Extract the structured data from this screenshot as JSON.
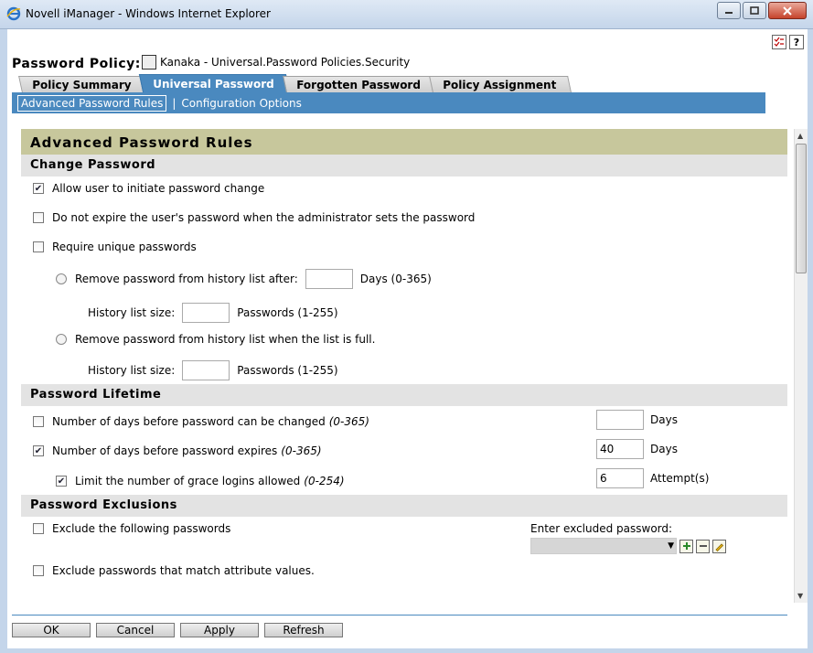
{
  "window": {
    "title": "Novell iManager - Windows Internet Explorer"
  },
  "header": {
    "policy_label": "Password Policy:",
    "policy_object": "Kanaka - Universal.Password Policies.Security",
    "help_icons": [
      "checklist-icon",
      "help-icon"
    ]
  },
  "tabs": [
    {
      "label": "Policy Summary",
      "active": false
    },
    {
      "label": "Universal Password",
      "active": true
    },
    {
      "label": "Forgotten Password",
      "active": false
    },
    {
      "label": "Policy Assignment",
      "active": false
    }
  ],
  "subnav": {
    "items": [
      {
        "label": "Advanced Password Rules",
        "active": true
      },
      {
        "label": "Configuration Options",
        "active": false
      }
    ],
    "separator": "|"
  },
  "panel": {
    "title": "Advanced Password Rules",
    "change_password": {
      "heading": "Change Password",
      "allow_user_change": {
        "label": "Allow user to initiate password change",
        "checked": true
      },
      "no_expire_admin": {
        "label": "Do not expire the user's password when the administrator sets the password",
        "checked": false
      },
      "require_unique": {
        "label": "Require unique passwords",
        "checked": false
      },
      "remove_after": {
        "label": "Remove password from history list after:",
        "value": "",
        "unit": "Days (0-365)"
      },
      "history_size_1": {
        "label": "History list size:",
        "value": "",
        "unit": "Passwords (1-255)"
      },
      "remove_when_full": {
        "label": "Remove password from history list when the list is full."
      },
      "history_size_2": {
        "label": "History list size:",
        "value": "",
        "unit": "Passwords (1-255)"
      }
    },
    "lifetime": {
      "heading": "Password Lifetime",
      "days_before_change": {
        "label": "Number of days before password can be changed",
        "range": "(0-365)",
        "checked": false,
        "value": "",
        "unit": "Days"
      },
      "days_before_expire": {
        "label": "Number of days before password expires",
        "range": "(0-365)",
        "checked": true,
        "value": "40",
        "unit": "Days"
      },
      "grace_logins": {
        "label": "Limit the number of grace logins allowed",
        "range": "(0-254)",
        "checked": true,
        "value": "6",
        "unit": "Attempt(s)"
      }
    },
    "exclusions": {
      "heading": "Password Exclusions",
      "exclude_following": {
        "label": "Exclude the following passwords",
        "checked": false
      },
      "enter_excluded": {
        "label": "Enter excluded password:",
        "value": ""
      },
      "exclude_attribute": {
        "label": "Exclude passwords that match attribute values.",
        "checked": false,
        "value": ""
      }
    }
  },
  "footer": {
    "ok": "OK",
    "cancel": "Cancel",
    "apply": "Apply",
    "refresh": "Refresh"
  },
  "colors": {
    "accent": "#4a89bf",
    "panel_header": "#c7c79c",
    "section": "#e3e3e3"
  }
}
